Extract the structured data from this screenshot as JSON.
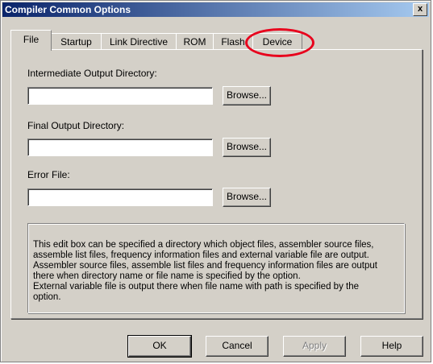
{
  "window": {
    "title": "Compiler Common Options",
    "close_glyph": "x"
  },
  "tabs": [
    {
      "label": "File",
      "selected": true
    },
    {
      "label": "Startup",
      "selected": false
    },
    {
      "label": "Link Directive",
      "selected": false
    },
    {
      "label": "ROM",
      "selected": false
    },
    {
      "label": "Flash",
      "selected": false
    },
    {
      "label": "Device",
      "selected": false
    }
  ],
  "file_tab": {
    "intermediate_label": "Intermediate Output Directory:",
    "intermediate_value": "",
    "final_label": "Final Output Directory:",
    "final_value": "",
    "error_label": "Error File:",
    "error_value": "",
    "browse_label": "Browse...",
    "description_lines": [
      "This edit box can be specified a directory which object files, assembler source files,",
      "assemble list files, frequency information files and external variable file are output.",
      "Assembler source files, assemble list files and frequency information files are output",
      "there when directory name or file name is specified by the option.",
      "External variable file is output there when file name with path is specified by the",
      "option."
    ]
  },
  "buttons": {
    "ok": "OK",
    "cancel": "Cancel",
    "apply": "Apply",
    "help": "Help"
  },
  "annotation": {
    "color": "#e8001c",
    "target": "Device"
  }
}
